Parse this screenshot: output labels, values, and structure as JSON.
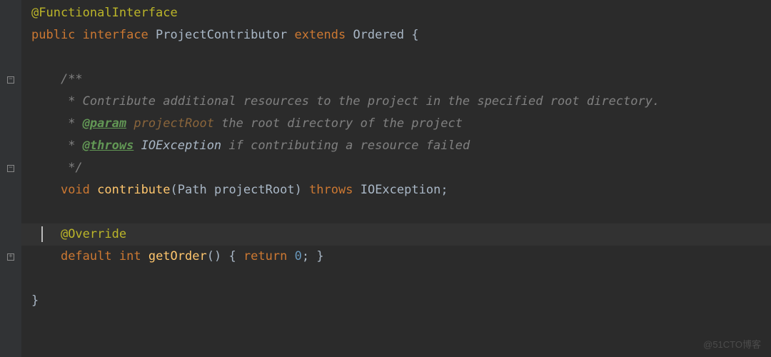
{
  "code": {
    "line1_annotation": "@FunctionalInterface",
    "line2_public": "public",
    "line2_interface": "interface",
    "line2_class": "ProjectContributor",
    "line2_extends": "extends",
    "line2_ordered": "Ordered",
    "line2_brace": "{",
    "line4_comment": "/**",
    "line5_star": " * ",
    "line5_text": "Contribute additional resources to the project in the specified root directory.",
    "line6_star": " * ",
    "line6_tag": "@param",
    "line6_param": "projectRoot",
    "line6_desc": "the root directory of the project",
    "line7_star": " * ",
    "line7_tag": "@throws",
    "line7_class": "IOException",
    "line7_desc": "if contributing a resource failed",
    "line8_comment": " */",
    "line9_void": "void",
    "line9_method": "contribute",
    "line9_type": "Path",
    "line9_param": "projectRoot",
    "line9_throws": "throws",
    "line9_exception": "IOException",
    "line11_annotation": "@Override",
    "line12_default": "default",
    "line12_int": "int",
    "line12_method": "getOrder",
    "line12_return": "return",
    "line12_value": "0",
    "line14_brace": "}"
  },
  "watermark": "@51CTO博客"
}
